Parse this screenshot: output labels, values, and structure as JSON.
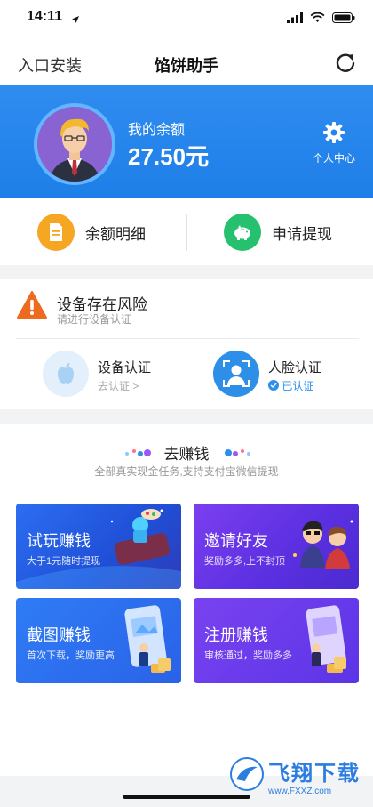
{
  "status_bar": {
    "time": "14:11"
  },
  "nav": {
    "left": "入口安装",
    "title": "馅饼助手"
  },
  "balance": {
    "label": "我的余额",
    "amount": "27.50元",
    "profile_label": "个人中心"
  },
  "quick_actions": [
    {
      "label": "余额明细",
      "icon": "document-icon",
      "color": "#f5a623"
    },
    {
      "label": "申请提现",
      "icon": "piggy-bank-icon",
      "color": "#25c16f"
    }
  ],
  "risk": {
    "title": "设备存在风险",
    "subtitle": "请进行设备认证",
    "device_auth": {
      "title": "设备认证",
      "status": "去认证 >"
    },
    "face_auth": {
      "title": "人脸认证",
      "status": "已认证"
    }
  },
  "earn": {
    "title": "去赚钱",
    "subtitle": "全部真实现金任务,支持支付宝微信提现",
    "cards": [
      {
        "title": "试玩赚钱",
        "sub": "大于1元随时提现"
      },
      {
        "title": "邀请好友",
        "sub": "奖励多多,上不封顶"
      },
      {
        "title": "截图赚钱",
        "sub": "首次下载，奖励更高"
      },
      {
        "title": "注册赚钱",
        "sub": "审核通过，奖励多多"
      }
    ]
  },
  "watermark": {
    "title": "飞翔下载",
    "url": "www.FXXZ.com"
  },
  "colors": {
    "brand_blue": "#2f8cf0",
    "orange": "#f5a623",
    "green": "#25c16f"
  }
}
